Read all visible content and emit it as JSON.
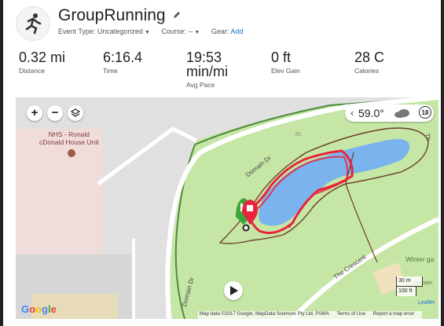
{
  "activity": {
    "title": "GroupRunning",
    "event_type_label": "Event Type:",
    "event_type_value": "Uncategorized",
    "course_label": "Course:",
    "course_value": "--",
    "gear_label": "Gear:",
    "gear_add": "Add"
  },
  "stats": [
    {
      "value": "0.32 mi",
      "label": "Distance"
    },
    {
      "value": "6:16.4",
      "label": "Time"
    },
    {
      "value": "19:53",
      "value2": "min/mi",
      "label": "Avg Pace"
    },
    {
      "value": "0 ft",
      "label": "Elev Gain"
    },
    {
      "value": "28 C",
      "label": "Calories"
    }
  ],
  "map": {
    "zoom_in": "+",
    "zoom_out": "−",
    "weather_temp": "59.0°",
    "weather_chevron": "‹",
    "wind_speed": "18",
    "poi_label_line1": "NHS - Ronald",
    "poi_label_line2": "cDonald House Unit",
    "road_domain_dr_1": "Domain Dr",
    "road_domain_dr_2": "Domain Dr",
    "road_crescent": "The Crescent",
    "road_edge": "Th",
    "park_label": "Winter ga",
    "park_label_2": "Domain",
    "label_35": "35",
    "scale_m": "30 m",
    "scale_ft": "100 ft",
    "leaflet": "Leaflet",
    "google_logo": "Google",
    "attribution_data": "Map data ©2017 Google, MapData Sciences Pty Ltd, PSMA",
    "attribution_terms": "Terms of Use",
    "attribution_report": "Report a map error"
  },
  "colors": {
    "route": "#e8243c",
    "start_marker": "#3aa63a",
    "end_marker": "#e8243c",
    "water": "#7ab3ee",
    "park": "#c6e6a6",
    "link": "#1a73c8"
  }
}
